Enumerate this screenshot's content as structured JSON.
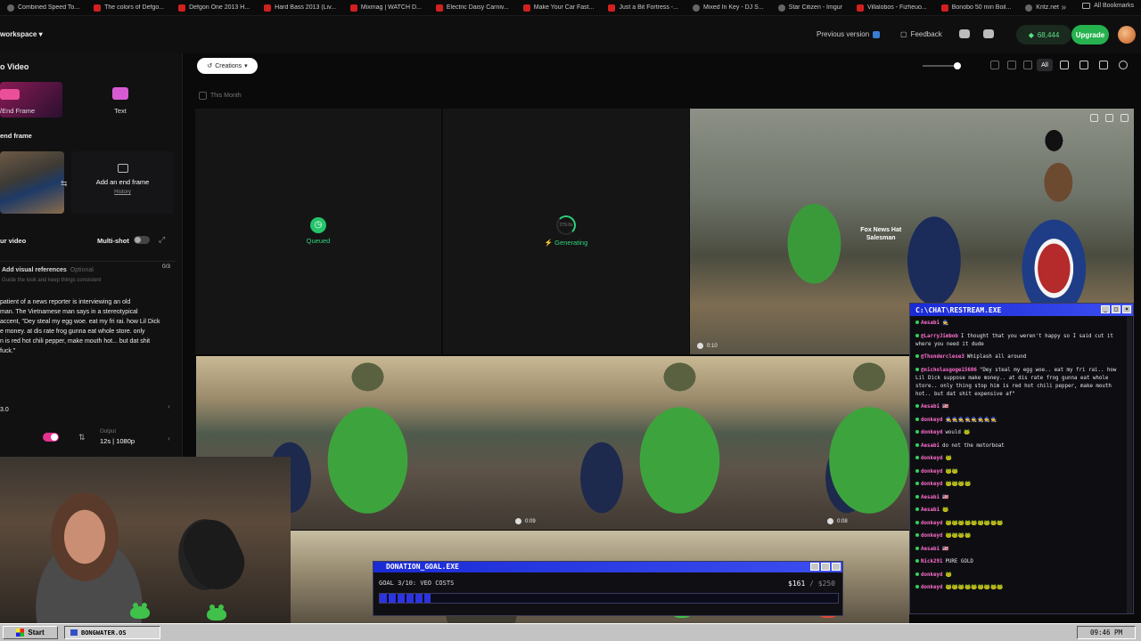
{
  "bookmarks": [
    {
      "label": "Combined Speed To..."
    },
    {
      "label": "The colors of Defgo..."
    },
    {
      "label": "Defgon One 2013 H..."
    },
    {
      "label": "Hard Bass 2013 (Liv..."
    },
    {
      "label": "Mixmag | WATCH D..."
    },
    {
      "label": "Electric Daisy Carniv..."
    },
    {
      "label": "Make Your Car Fast..."
    },
    {
      "label": "Just a Bit Fortress -..."
    },
    {
      "label": "Mixed In Key - DJ S..."
    },
    {
      "label": "Star Citizen - Imgur"
    },
    {
      "label": "Villalobos - Fizheuo..."
    },
    {
      "label": "Bonobo 50 min Boil..."
    },
    {
      "label": "Kritz.net"
    }
  ],
  "bookmarks_all": "All Bookmarks",
  "topbar": {
    "workspace": "workspace",
    "previous_version": "Previous version",
    "feedback": "Feedback",
    "credits": "68,444",
    "upgrade": "Upgrade"
  },
  "left": {
    "title": "o Video",
    "mode_frames": "/End Frame",
    "mode_text": "Text",
    "end_frame_label": "end frame",
    "add_end_frame": "Add an end frame",
    "history": "History",
    "your_video": "ur video",
    "multishot": "Multi-shot",
    "visual_refs_title": "Add visual references",
    "visual_refs_optional": "Optional",
    "visual_refs_sub": "Guide the look and keep things consistent",
    "visual_refs_count": "0/3",
    "prompt": "patient of a news reporter is interviewing an old\nman. The Vietnamese man says in a stereotypical\naccent, \"Dey steal my egg woe. eat my fri rai. how Lil Dick\ne money. at dis rate frog gunna eat whole store. only\nn is red hot chili pepper, make mouth hot... but dat shit\nfuck.\"",
    "model": "3.0",
    "output_label": "Output",
    "output_value": "12s | 1080p"
  },
  "main": {
    "creations": "Creations",
    "filter_all": "All",
    "this_month": "This Month",
    "queued": "Queued",
    "generating": "Generating",
    "progress_text": "279.0s",
    "sign_text": "Fox News\nHat Salesman",
    "durations": [
      "0:10",
      "0:09",
      "0:08"
    ]
  },
  "chat": {
    "title": "C:\\CHAT\\RESTREAM.EXE",
    "messages": [
      {
        "user": "Aesabi",
        "text": "🧙",
        "color": "#ff6fcf"
      },
      {
        "user": "@LarryJimbob",
        "text": "I thought that you weren't happy so I said cut it where you need it dude",
        "color": "#ff6fcf"
      },
      {
        "user": "@Thunderclese3",
        "text": "Whiplash all around",
        "color": "#ff6fcf"
      },
      {
        "user": "@nicholasgoge15606",
        "text": "\"Dey steal my egg woe.. eat my fri rai.. how Lil Dick suppose make money.. at dis rate frog gunna eat whole store.. only thing stop him is red hot chili pepper, make mouth hot.. but dat shit expensive af\"",
        "color": "#ff6fcf"
      },
      {
        "user": "Aesabi",
        "text": "🇺🇸",
        "color": "#ff6fcf"
      },
      {
        "user": "donkeyd",
        "text": "🧙🧙🧙🧙🧙🧙🧙🧙",
        "color": "#ff6fcf"
      },
      {
        "user": "donkeyd",
        "text": "would 🐸",
        "color": "#ff6fcf"
      },
      {
        "user": "Aesabi",
        "text": "do not the motorboat",
        "color": "#ff6fcf"
      },
      {
        "user": "donkeyd",
        "text": "🐸",
        "color": "#ff6fcf"
      },
      {
        "user": "donkeyd",
        "text": "🐸🐸",
        "color": "#ff6fcf"
      },
      {
        "user": "donkeyd",
        "text": "🐸🐸🐸🐸",
        "color": "#ff6fcf"
      },
      {
        "user": "Aesabi",
        "text": "🇺🇸",
        "color": "#ff6fcf"
      },
      {
        "user": "Aesabi",
        "text": "🐸",
        "color": "#ff6fcf"
      },
      {
        "user": "donkeyd",
        "text": "🐸🐸🐸🐸🐸🐸🐸🐸🐸",
        "color": "#ff6fcf"
      },
      {
        "user": "donkeyd",
        "text": "🐸🐸🐸🐸",
        "color": "#ff6fcf"
      },
      {
        "user": "Aesabi",
        "text": "🇺🇸",
        "color": "#ff6fcf"
      },
      {
        "user": "Nick291",
        "text": "PURE GOLD",
        "color": "#ff6fcf"
      },
      {
        "user": "donkeyd",
        "text": "🐸",
        "color": "#ff6fcf"
      },
      {
        "user": "donkeyd",
        "text": "🐸🐸🐸🐸🐸🐸🐸🐸🐸",
        "color": "#ff6fcf"
      }
    ]
  },
  "donation": {
    "title": "DONATION_GOAL.EXE",
    "goal": "GOAL 3/10: VEO COSTS",
    "current": "$161",
    "target": "/ $250",
    "progress": 0.11
  },
  "taskbar": {
    "start": "Start",
    "task": "BONGWATER.OS",
    "time": "09:46 PM"
  },
  "colors": {
    "accent_green": "#26b24e",
    "status_green": "#2ed47a",
    "accent_pink": "#e4338f",
    "win_blue": "#1a2bd6"
  }
}
